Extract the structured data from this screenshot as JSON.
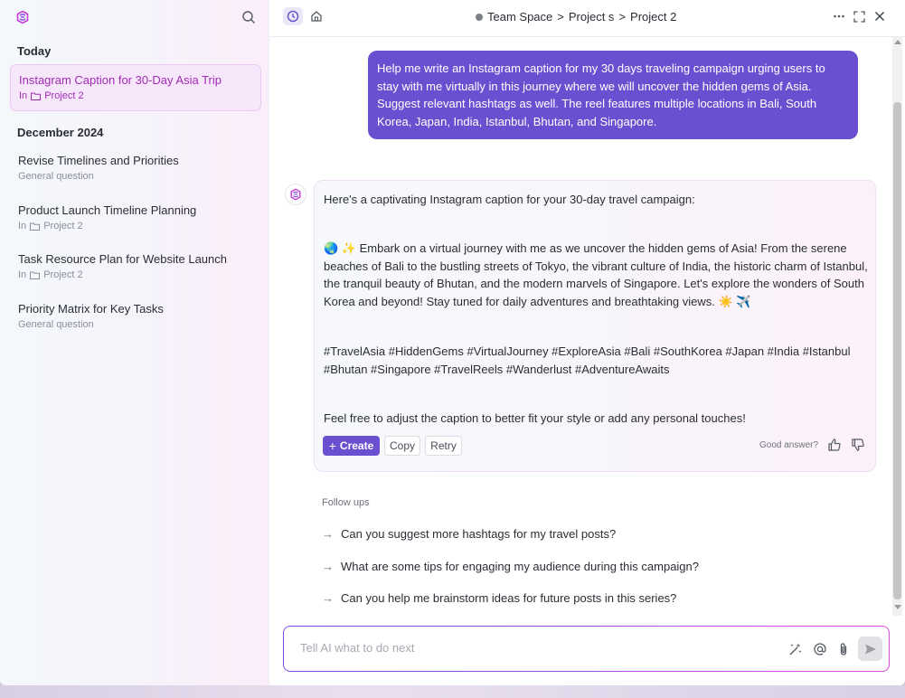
{
  "sidebar": {
    "groups": [
      {
        "title": "Today"
      },
      {
        "title": "December 2024"
      }
    ],
    "items": [
      {
        "title": "Instagram Caption for 30-Day Asia Trip",
        "prefix": "In",
        "folder": "Project 2"
      },
      {
        "title": "Revise Timelines and Priorities",
        "subtitle": "General question"
      },
      {
        "title": "Product Launch Timeline Planning",
        "prefix": "In",
        "folder": "Project 2"
      },
      {
        "title": "Task Resource Plan for Website Launch",
        "prefix": "In",
        "folder": "Project 2"
      },
      {
        "title": "Priority Matrix for Key Tasks",
        "subtitle": "General question"
      }
    ]
  },
  "header": {
    "breadcrumb": [
      "Team Space",
      "Project s",
      "Project 2"
    ],
    "sep": ">"
  },
  "conversation": {
    "user_message": "Help me write an Instagram caption for my 30 days traveling campaign urging users to stay with me virtually in this journey where we will uncover the hidden gems of Asia. Suggest relevant hashtags as well. The reel features multiple locations in Bali, South Korea, Japan, India, Istanbul, Bhutan, and Singapore.",
    "ai_intro": "Here's a captivating Instagram caption for your 30-day travel campaign:",
    "ai_caption": "🌏 ✨ Embark on a virtual journey with me as we uncover the hidden gems of Asia! From the serene beaches of Bali to the bustling streets of Tokyo, the vibrant culture of India, the historic charm of Istanbul, the tranquil beauty of Bhutan, and the modern marvels of Singapore. Let's explore the wonders of South Korea and beyond! Stay tuned for daily adventures and breathtaking views. ☀️ ✈️",
    "ai_hashtags": "#TravelAsia #HiddenGems #VirtualJourney #ExploreAsia #Bali #SouthKorea #Japan #India #Istanbul #Bhutan #Singapore #TravelReels #Wanderlust #AdventureAwaits",
    "ai_outro": "Feel free to adjust the caption to better fit your style or add any personal touches!",
    "actions": {
      "create": "Create",
      "copy": "Copy",
      "retry": "Retry",
      "good_answer": "Good answer?"
    },
    "followups_title": "Follow ups",
    "followups": [
      "Can you suggest more hashtags for my travel posts?",
      "What are some tips for engaging my audience during this campaign?",
      "Can you help me brainstorm ideas for future posts in this series?"
    ]
  },
  "input": {
    "placeholder": "Tell AI what to do next"
  },
  "colors": {
    "accent": "#6a4fd0",
    "active_text": "#a12ab5"
  }
}
